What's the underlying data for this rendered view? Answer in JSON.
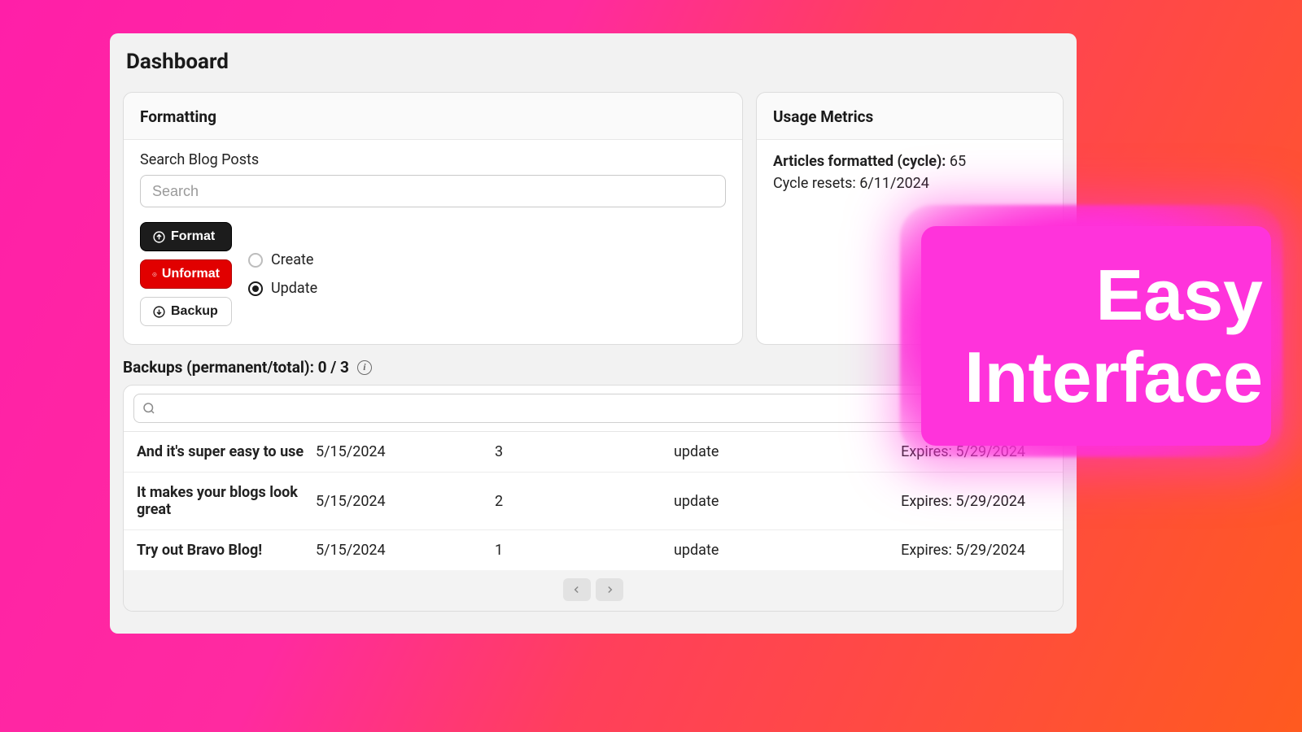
{
  "page": {
    "title": "Dashboard"
  },
  "formatting": {
    "header": "Formatting",
    "search_label": "Search Blog Posts",
    "search_placeholder": "Search",
    "buttons": {
      "format": "Format",
      "unformat": "Unformat",
      "backup": "Backup"
    },
    "radios": {
      "create": "Create",
      "update": "Update",
      "selected": "update"
    }
  },
  "metrics": {
    "header": "Usage Metrics",
    "formatted_label": "Articles formatted (cycle):",
    "formatted_value": "65",
    "reset_label": "Cycle resets:",
    "reset_value": "6/11/2024"
  },
  "backups": {
    "title_prefix": "Backups (permanent/total): ",
    "title_value": "0 / 3",
    "rows": [
      {
        "title": "And it's super easy to use",
        "date": "5/15/2024",
        "count": "3",
        "type": "update",
        "expires": "Expires: 5/29/2024"
      },
      {
        "title": "It makes your blogs look great",
        "date": "5/15/2024",
        "count": "2",
        "type": "update",
        "expires": "Expires: 5/29/2024"
      },
      {
        "title": "Try out Bravo Blog!",
        "date": "5/15/2024",
        "count": "1",
        "type": "update",
        "expires": "Expires: 5/29/2024"
      }
    ]
  },
  "callout": {
    "line1": "Easy",
    "line2": "Interface"
  },
  "colors": {
    "format_btn": "#1c1c1c",
    "unformat_btn": "#e10000",
    "callout_bg": "#ff33db"
  }
}
